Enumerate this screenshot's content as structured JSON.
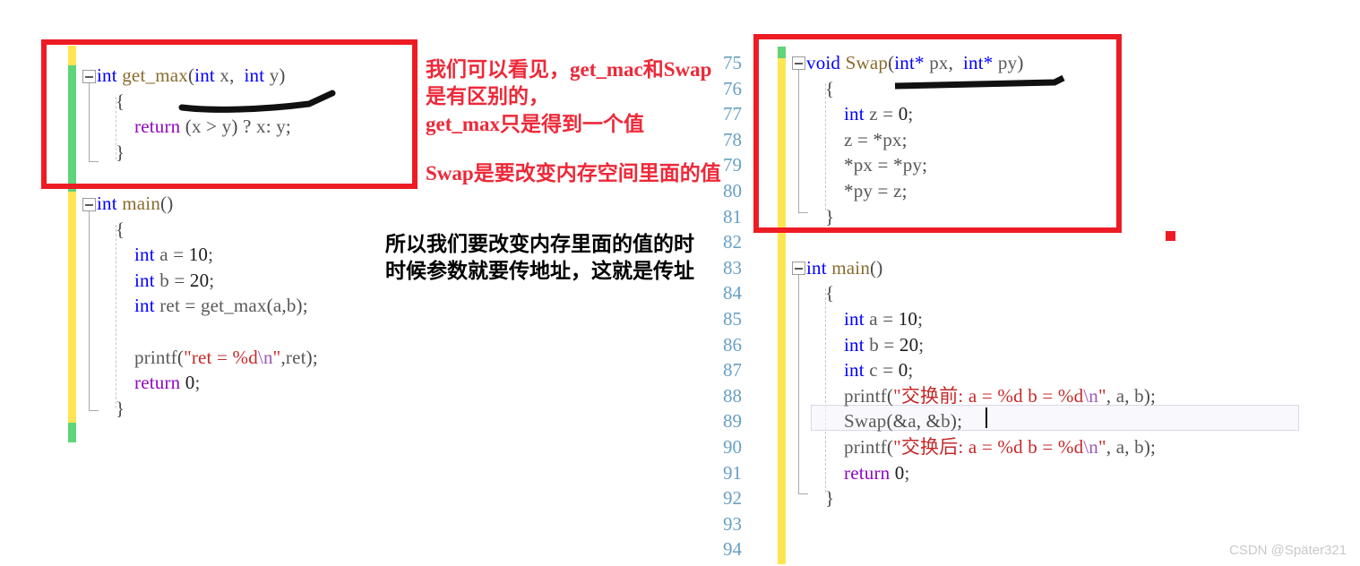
{
  "watermark": "CSDN @Später321",
  "left_pane": {
    "name": "left-code-editor",
    "lines": [
      {
        "segments": [
          {
            "t": "int ",
            "c": "kw"
          },
          {
            "t": "get_max",
            "c": "fn"
          },
          {
            "t": "(",
            "c": "punct"
          },
          {
            "t": "int ",
            "c": "kw"
          },
          {
            "t": "x",
            "c": "id"
          },
          {
            "t": ",  ",
            "c": "punct"
          },
          {
            "t": "int ",
            "c": "kw"
          },
          {
            "t": "y",
            "c": "id"
          },
          {
            "t": ")",
            "c": "punct"
          }
        ],
        "indent": 0,
        "fold": true
      },
      {
        "segments": [
          {
            "t": "{",
            "c": "punct"
          }
        ],
        "indent": 1
      },
      {
        "segments": [
          {
            "t": "return",
            "c": "kw-ret"
          },
          {
            "t": " (",
            "c": "punct"
          },
          {
            "t": "x",
            "c": "id"
          },
          {
            "t": " > ",
            "c": "punct"
          },
          {
            "t": "y",
            "c": "id"
          },
          {
            "t": ") ? ",
            "c": "punct"
          },
          {
            "t": "x",
            "c": "id"
          },
          {
            "t": ": ",
            "c": "punct"
          },
          {
            "t": "y",
            "c": "id"
          },
          {
            "t": ";",
            "c": "punct"
          }
        ],
        "indent": 2
      },
      {
        "segments": [
          {
            "t": "}",
            "c": "punct"
          }
        ],
        "indent": 1
      },
      {
        "segments": [],
        "indent": 0
      },
      {
        "segments": [
          {
            "t": "int ",
            "c": "kw"
          },
          {
            "t": "main",
            "c": "fn"
          },
          {
            "t": "()",
            "c": "punct"
          }
        ],
        "indent": 0,
        "fold": true
      },
      {
        "segments": [
          {
            "t": "{",
            "c": "punct"
          }
        ],
        "indent": 1
      },
      {
        "segments": [
          {
            "t": "int ",
            "c": "kw"
          },
          {
            "t": "a",
            "c": "id"
          },
          {
            "t": " = ",
            "c": "punct"
          },
          {
            "t": "10",
            "c": "num"
          },
          {
            "t": ";",
            "c": "punct"
          }
        ],
        "indent": 2
      },
      {
        "segments": [
          {
            "t": "int ",
            "c": "kw"
          },
          {
            "t": "b",
            "c": "id"
          },
          {
            "t": " = ",
            "c": "punct"
          },
          {
            "t": "20",
            "c": "num"
          },
          {
            "t": ";",
            "c": "punct"
          }
        ],
        "indent": 2
      },
      {
        "segments": [
          {
            "t": "int ",
            "c": "kw"
          },
          {
            "t": "ret",
            "c": "id"
          },
          {
            "t": " = ",
            "c": "punct"
          },
          {
            "t": "get_max",
            "c": "id"
          },
          {
            "t": "(",
            "c": "punct"
          },
          {
            "t": "a",
            "c": "id"
          },
          {
            "t": ",",
            "c": "punct"
          },
          {
            "t": "b",
            "c": "id"
          },
          {
            "t": ");",
            "c": "punct"
          }
        ],
        "indent": 2
      },
      {
        "segments": [],
        "indent": 2
      },
      {
        "segments": [
          {
            "t": "printf",
            "c": "id"
          },
          {
            "t": "(",
            "c": "punct"
          },
          {
            "t": "\"ret = %d",
            "c": "str"
          },
          {
            "t": "\\n",
            "c": "esc"
          },
          {
            "t": "\"",
            "c": "str"
          },
          {
            "t": ",",
            "c": "punct"
          },
          {
            "t": "ret",
            "c": "id"
          },
          {
            "t": ");",
            "c": "punct"
          }
        ],
        "indent": 2
      },
      {
        "segments": [
          {
            "t": "return",
            "c": "kw-ret"
          },
          {
            "t": " ",
            "c": "punct"
          },
          {
            "t": "0",
            "c": "num"
          },
          {
            "t": ";",
            "c": "punct"
          }
        ],
        "indent": 2
      },
      {
        "segments": [
          {
            "t": "}",
            "c": "punct"
          }
        ],
        "indent": 1
      }
    ]
  },
  "right_pane": {
    "name": "right-code-editor",
    "line_numbers": [
      "75",
      "76",
      "77",
      "78",
      "79",
      "80",
      "81",
      "82",
      "83",
      "84",
      "85",
      "86",
      "87",
      "88",
      "89",
      "90",
      "91",
      "92",
      "93",
      "94"
    ],
    "lines": [
      {
        "segments": [
          {
            "t": "void ",
            "c": "kw"
          },
          {
            "t": "Swap",
            "c": "fn"
          },
          {
            "t": "(",
            "c": "punct"
          },
          {
            "t": "int*",
            "c": "kw"
          },
          {
            "t": " px",
            "c": "id"
          },
          {
            "t": ",  ",
            "c": "punct"
          },
          {
            "t": "int*",
            "c": "kw"
          },
          {
            "t": " py",
            "c": "id"
          },
          {
            "t": ")",
            "c": "punct"
          }
        ],
        "indent": 0,
        "fold": true
      },
      {
        "segments": [
          {
            "t": "{",
            "c": "punct"
          }
        ],
        "indent": 1
      },
      {
        "segments": [
          {
            "t": "int ",
            "c": "kw"
          },
          {
            "t": "z",
            "c": "id"
          },
          {
            "t": " = ",
            "c": "punct"
          },
          {
            "t": "0",
            "c": "num"
          },
          {
            "t": ";",
            "c": "punct"
          }
        ],
        "indent": 2
      },
      {
        "segments": [
          {
            "t": "z",
            "c": "id"
          },
          {
            "t": " = *",
            "c": "punct"
          },
          {
            "t": "px",
            "c": "id"
          },
          {
            "t": ";",
            "c": "punct"
          }
        ],
        "indent": 2
      },
      {
        "segments": [
          {
            "t": "*",
            "c": "punct"
          },
          {
            "t": "px",
            "c": "id"
          },
          {
            "t": " = *",
            "c": "punct"
          },
          {
            "t": "py",
            "c": "id"
          },
          {
            "t": ";",
            "c": "punct"
          }
        ],
        "indent": 2
      },
      {
        "segments": [
          {
            "t": "*",
            "c": "punct"
          },
          {
            "t": "py",
            "c": "id"
          },
          {
            "t": " = ",
            "c": "punct"
          },
          {
            "t": "z",
            "c": "id"
          },
          {
            "t": ";",
            "c": "punct"
          }
        ],
        "indent": 2
      },
      {
        "segments": [
          {
            "t": "}",
            "c": "punct"
          }
        ],
        "indent": 1
      },
      {
        "segments": [],
        "indent": 0
      },
      {
        "segments": [
          {
            "t": "int ",
            "c": "kw"
          },
          {
            "t": "main",
            "c": "fn"
          },
          {
            "t": "()",
            "c": "punct"
          }
        ],
        "indent": 0,
        "fold": true
      },
      {
        "segments": [
          {
            "t": "{",
            "c": "punct"
          }
        ],
        "indent": 1
      },
      {
        "segments": [
          {
            "t": "int ",
            "c": "kw"
          },
          {
            "t": "a",
            "c": "id"
          },
          {
            "t": " = ",
            "c": "punct"
          },
          {
            "t": "10",
            "c": "num"
          },
          {
            "t": ";",
            "c": "punct"
          }
        ],
        "indent": 2
      },
      {
        "segments": [
          {
            "t": "int ",
            "c": "kw"
          },
          {
            "t": "b",
            "c": "id"
          },
          {
            "t": " = ",
            "c": "punct"
          },
          {
            "t": "20",
            "c": "num"
          },
          {
            "t": ";",
            "c": "punct"
          }
        ],
        "indent": 2
      },
      {
        "segments": [
          {
            "t": "int ",
            "c": "kw"
          },
          {
            "t": "c",
            "c": "id"
          },
          {
            "t": " = ",
            "c": "punct"
          },
          {
            "t": "0",
            "c": "num"
          },
          {
            "t": ";",
            "c": "punct"
          }
        ],
        "indent": 2
      },
      {
        "segments": [
          {
            "t": "printf",
            "c": "id"
          },
          {
            "t": "(",
            "c": "punct"
          },
          {
            "t": "\"交换前: a = %d b = %d",
            "c": "str"
          },
          {
            "t": "\\n",
            "c": "esc"
          },
          {
            "t": "\"",
            "c": "str"
          },
          {
            "t": ", ",
            "c": "punct"
          },
          {
            "t": "a",
            "c": "id"
          },
          {
            "t": ", ",
            "c": "punct"
          },
          {
            "t": "b",
            "c": "id"
          },
          {
            "t": ");",
            "c": "punct"
          }
        ],
        "indent": 2
      },
      {
        "segments": [
          {
            "t": "Swap",
            "c": "id"
          },
          {
            "t": "(&",
            "c": "punct"
          },
          {
            "t": "a",
            "c": "id"
          },
          {
            "t": ", &",
            "c": "punct"
          },
          {
            "t": "b",
            "c": "id"
          },
          {
            "t": ");",
            "c": "punct"
          }
        ],
        "indent": 2,
        "current": true
      },
      {
        "segments": [
          {
            "t": "printf",
            "c": "id"
          },
          {
            "t": "(",
            "c": "punct"
          },
          {
            "t": "\"交换后: a = %d b = %d",
            "c": "str"
          },
          {
            "t": "\\n",
            "c": "esc"
          },
          {
            "t": "\"",
            "c": "str"
          },
          {
            "t": ", ",
            "c": "punct"
          },
          {
            "t": "a",
            "c": "id"
          },
          {
            "t": ", ",
            "c": "punct"
          },
          {
            "t": "b",
            "c": "id"
          },
          {
            "t": ");",
            "c": "punct"
          }
        ],
        "indent": 2
      },
      {
        "segments": [
          {
            "t": "return",
            "c": "kw-ret"
          },
          {
            "t": " ",
            "c": "punct"
          },
          {
            "t": "0",
            "c": "num"
          },
          {
            "t": ";",
            "c": "punct"
          }
        ],
        "indent": 2
      },
      {
        "segments": [
          {
            "t": "}",
            "c": "punct"
          }
        ],
        "indent": 1
      },
      {
        "segments": [],
        "indent": 0
      },
      {
        "segments": [],
        "indent": 0
      }
    ]
  },
  "annotations": {
    "red_note_line1": "我们可以看见，get_mac和Swap",
    "red_note_line2": "是有区别的，",
    "red_note_line3": "get_max只是得到一个值",
    "red_note_line4": "Swap是要改变内存空间里面的值",
    "black_note_line1": "所以我们要改变内存里面的值的时",
    "black_note_line2": "时候参数就要传地址，这就是传址"
  },
  "colors": {
    "highlight_box": "#ed1c24",
    "annotation_red": "#ed2939",
    "annotation_black": "#000000",
    "changebar_saved": "#5fd47a",
    "changebar_unsaved": "#ffe552",
    "line_number": "#67a0c4",
    "keyword": "#0000ff",
    "function": "#8a6b2e",
    "string": "#c62828",
    "return_keyword": "#8f08c4"
  }
}
